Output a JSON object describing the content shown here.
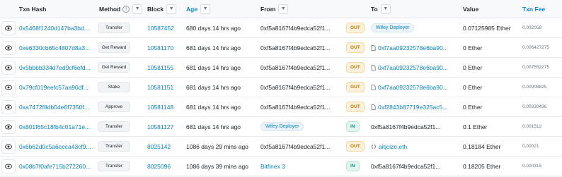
{
  "headers": {
    "txn_hash": "Txn Hash",
    "method": "Method",
    "block": "Block",
    "age": "Age",
    "from": "From",
    "to": "To",
    "value": "Value",
    "txn_fee": "Txn Fee"
  },
  "rows": [
    {
      "hash": "0x5468f1240d147ba3bd...",
      "method": "Transfer",
      "block": "10587452",
      "age": "680 days 14 hrs ago",
      "from": "0xf5a8167f4b9edca52f1...",
      "dir": "OUT",
      "to": "Wifey Deployer",
      "to_kind": "tag",
      "value": "0.07125985 Ether",
      "fee": "0.002058"
    },
    {
      "hash": "0xe6330cb65c4807d8a3...",
      "method": "Get Reward",
      "block": "10581170",
      "age": "681 days 14 hrs ago",
      "from": "0xf5a8167f4b9edca52f1...",
      "dir": "OUT",
      "to": "0xf7aa09232578e6ba90...",
      "to_kind": "contract",
      "value": "0 Ether",
      "fee": "0.006427275"
    },
    {
      "hash": "0x5bbbb334d7ed9cf6efd...",
      "method": "Get Reward",
      "block": "10581155",
      "age": "681 days 14 hrs ago",
      "from": "0xf5a8167f4b9edca52f1...",
      "dir": "OUT",
      "to": "0xf7aa09232578e6ba90...",
      "to_kind": "contract",
      "value": "0 Ether",
      "fee": "0.007552275"
    },
    {
      "hash": "0x79cf019eefc57aa90df...",
      "method": "Stake",
      "block": "10581151",
      "age": "681 days 14 hrs ago",
      "from": "0xf5a8167f4b9edca52f1...",
      "dir": "OUT",
      "to": "0xf7aa09232578e6ba90...",
      "to_kind": "contract",
      "value": "0 Ether",
      "fee": "0.00908825"
    },
    {
      "hash": "0xa7472f8db04e6f7350f...",
      "method": "Approve",
      "block": "10581148",
      "age": "681 days 14 hrs ago",
      "from": "0xf5a8167f4b9edca52f1...",
      "dir": "OUT",
      "to": "0xf2843b87719e325ac5...",
      "to_kind": "contract",
      "value": "0 Ether",
      "fee": "0.00330436"
    },
    {
      "hash": "0x801f65c18fb4c01a71e...",
      "method": "Transfer",
      "block": "10581127",
      "age": "681 days 14 hrs ago",
      "from": "Wifey Deployer",
      "from_kind": "tag",
      "dir": "IN",
      "to": "0xf5a8167f4b9edca52f1...",
      "to_kind": "plain",
      "value": "0.1 Ether",
      "fee": "0.001512"
    },
    {
      "hash": "0x6b62d0c5a6ceca43cf9...",
      "method": "Transfer",
      "block": "8025142",
      "age": "1086 days 29 mins ago",
      "from": "0xf5a8167f4b9edca52f1...",
      "dir": "OUT",
      "to": "aitjcize.eth",
      "to_kind": "ens",
      "value": "0.18184 Ether",
      "fee": "0.00021"
    },
    {
      "hash": "0x08b7f0afe715b272260...",
      "method": "Transfer",
      "block": "8025096",
      "age": "1086 days 39 mins ago",
      "from": "Bitfinex 3",
      "from_kind": "link",
      "dir": "IN",
      "to": "0xf5a8167f4b9edca52f1...",
      "to_kind": "plain",
      "value": "0.18205 Ether",
      "fee": "0.000315"
    }
  ],
  "icons": {
    "eye": "eye-icon",
    "filter": "filter-icon",
    "info": "info-icon",
    "contract": "contract-file-icon",
    "ens": "ens-icon"
  },
  "colors": {
    "link": "#0784c3",
    "out_bg": "#fdf1dc",
    "out_fg": "#b47d00",
    "in_bg": "#e3f6ee",
    "in_fg": "#00a186"
  }
}
